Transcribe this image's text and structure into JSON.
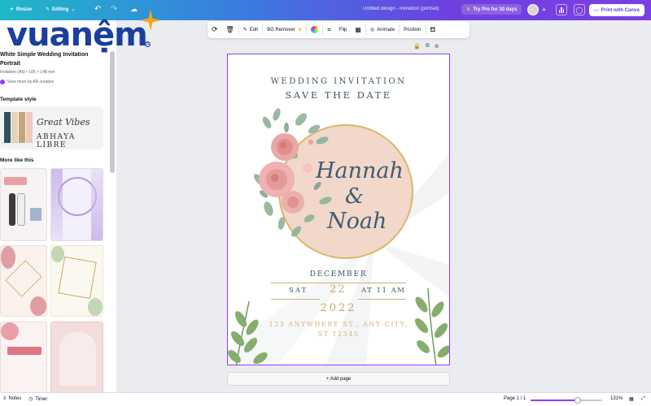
{
  "topbar": {
    "resize_label": "Resize",
    "editing_label": "Editing",
    "doc_title": "Untitled design - Invitation (portrait)",
    "try_pro_label": "Try Pro for 30 days",
    "print_label": "Print with Canva"
  },
  "logo": {
    "text": "vuanệm"
  },
  "panel": {
    "title": "White Simple Wedding Invitation Portrait",
    "size": "Invitation (A6) • 105 × 148 mm",
    "view_more": "View more by AR creative",
    "template_style_heading": "Template style",
    "style_font1": "Great Vibes",
    "style_font2": "ABHAYA LIBRE",
    "swatches": [
      "#2f5060",
      "#e6d3b5",
      "#c7a27a",
      "#ecc9bd"
    ],
    "more_like_heading": "More like this"
  },
  "toolbar": {
    "edit_label": "Edit",
    "bg_remover_label": "BG Remover",
    "flip_label": "Flip",
    "animate_label": "Animate",
    "position_label": "Position"
  },
  "invitation": {
    "heading1": "WEDDING INVITATION",
    "heading2": "SAVE THE DATE",
    "name1": "Hannah",
    "amp": "&",
    "name2": "Noah",
    "month": "DECEMBER",
    "weekday": "SAT",
    "day": "22",
    "time": "AT 11 AM",
    "year": "2022",
    "address1": "123 ANYWHERE ST., ANY CITY,",
    "address2": "ST 12345"
  },
  "canvas": {
    "add_page_label": "+ Add page"
  },
  "bottombar": {
    "notes_label": "Notes",
    "timer_label": "Timer",
    "page_indicator": "Page 1 / 1",
    "zoom_label": "131%",
    "zoom_fraction": 0.66
  },
  "colors": {
    "accent": "#8b3dff",
    "heading_text": "#3f5664",
    "gold": "#c9a560",
    "circle_fill": "#f1d8cb"
  }
}
